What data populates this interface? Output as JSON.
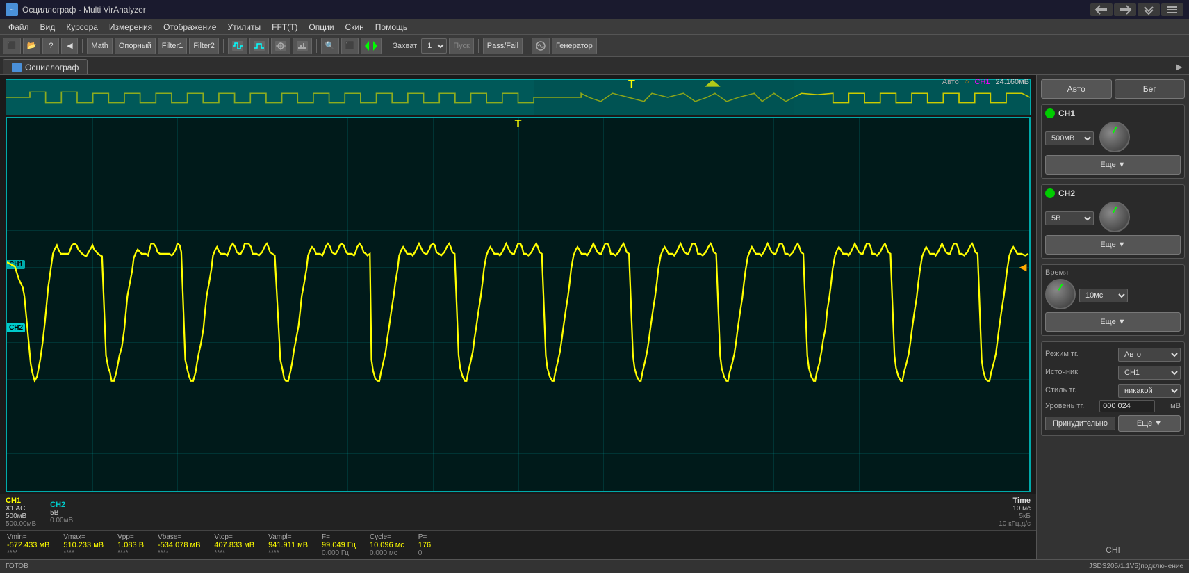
{
  "titlebar": {
    "title": "Осциллограф - Multi VirAnalyzer",
    "icon_label": "~"
  },
  "menubar": {
    "items": [
      "Файл",
      "Вид",
      "Курсора",
      "Измерения",
      "Отображение",
      "Утилиты",
      "FFT(T)",
      "Опции",
      "Скин",
      "Помощь"
    ]
  },
  "toolbar": {
    "buttons": [
      "⬛",
      "⬛",
      "?",
      "◀",
      "Math",
      "Опорный",
      "Filter1",
      "Filter2"
    ],
    "capture_label": "Захват",
    "capture_value": "1",
    "run_label": "Пуск",
    "passfail_label": "Pass/Fail",
    "generator_label": "Генератор",
    "wave_icons": [
      "~",
      "~",
      "⬛",
      "⬚"
    ]
  },
  "tab": {
    "label": "Осциллограф",
    "arrow": "▶"
  },
  "osc": {
    "status_auto": "Авто",
    "status_circle": "○",
    "status_ch1": "CH1",
    "status_value": "24.160мВ",
    "trigger_t": "T",
    "trigger_t2": "T"
  },
  "ch1_info": {
    "label": "CH1",
    "mode": "X1  AC",
    "volt": "500мВ",
    "volt2": "500.00мВ"
  },
  "ch2_info": {
    "label": "CH2",
    "volt": "5В",
    "volt2": "0.00мВ"
  },
  "time_info": {
    "label": "Time",
    "val1": "10 мс",
    "val2": "5кБ",
    "val3": "10 кГц.д/с"
  },
  "stats": {
    "vmin": {
      "label": "Vmin=",
      "val1": "-572.433 мВ",
      "val2": "****"
    },
    "vmax": {
      "label": "Vmax=",
      "val1": "510.233 мВ",
      "val2": "****"
    },
    "vpp": {
      "label": "Vpp=",
      "val1": "1.083 В",
      "val2": "****"
    },
    "vbase": {
      "label": "Vbase=",
      "val1": "-534.078 мВ",
      "val2": "****"
    },
    "vtop": {
      "label": "Vtop=",
      "val1": "407.833 мВ",
      "val2": "****"
    },
    "vampl": {
      "label": "Vampl=",
      "val1": "941.911 мВ",
      "val2": "****"
    },
    "freq": {
      "label": "F=",
      "val1": "99.049 Гц",
      "val2": "0.000 Гц"
    },
    "cycle": {
      "label": "Cycle=",
      "val1": "10.096 мс",
      "val2": "0.000 мс"
    },
    "p": {
      "label": "P=",
      "val1": "176",
      "val2": "0"
    }
  },
  "statusbar": {
    "left": "ГОТОВ",
    "right": "JSDS205/1.1V5)подключение"
  },
  "right_panel": {
    "auto_btn": "Авто",
    "run_btn": "Бег",
    "ch1": {
      "label": "CH1",
      "dot_color": "#00cc00",
      "volt_option": "500мВ",
      "more_btn": "Еще ▼"
    },
    "ch2": {
      "label": "CH2",
      "dot_color": "#00cc00",
      "volt_option": "5В",
      "more_btn": "Еще ▼"
    },
    "time": {
      "label": "Время",
      "value": "10мс",
      "more_btn": "Еще ▼"
    },
    "trigger": {
      "mode_label": "Режим тг.",
      "mode_value": "Авто",
      "source_label": "Источник",
      "source_value": "CH1",
      "style_label": "Стиль тг.",
      "style_value": "никакой",
      "level_label": "Уровень тг.",
      "level_value": "000 024",
      "level_unit": "мВ",
      "force_btn": "Принудительно",
      "more_btn": "Еще ▼"
    },
    "chi_label": "CHI"
  }
}
